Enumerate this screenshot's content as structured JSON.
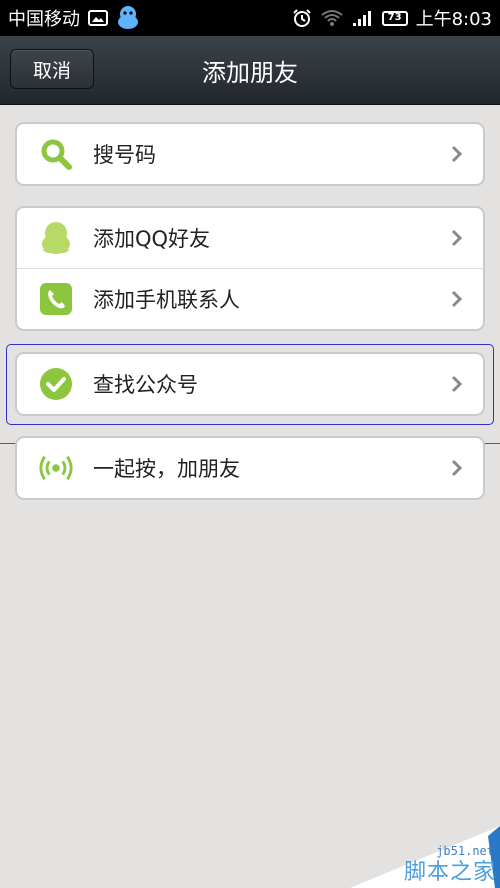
{
  "status_bar": {
    "carrier": "中国移动",
    "battery": "73",
    "time": "上午8:03",
    "icons": [
      "image-icon",
      "qq-penguin-icon",
      "alarm-icon",
      "wifi-icon",
      "signal-icon",
      "battery-icon"
    ]
  },
  "header": {
    "cancel_label": "取消",
    "title": "添加朋友"
  },
  "groups": [
    {
      "items": [
        {
          "label": "搜号码",
          "icon": "search-icon"
        }
      ]
    },
    {
      "items": [
        {
          "label": "添加QQ好友",
          "icon": "qq-penguin-icon"
        },
        {
          "label": "添加手机联系人",
          "icon": "phone-icon"
        }
      ]
    },
    {
      "items": [
        {
          "label": "查找公众号",
          "icon": "check-circle-icon"
        }
      ]
    },
    {
      "items": [
        {
          "label": "一起按，加朋友",
          "icon": "radar-signal-icon"
        }
      ]
    }
  ],
  "watermark": {
    "url": "jb51.net",
    "text": "脚本之家"
  },
  "colors": {
    "accent_green": "#8cc63f",
    "background": "#e3e2e0",
    "highlight_border": "#2b34c8",
    "red_line": "#d42b2b"
  }
}
